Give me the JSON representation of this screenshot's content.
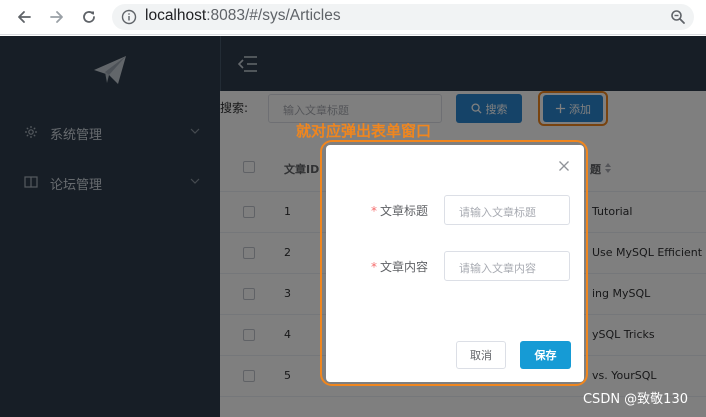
{
  "browser": {
    "url_host": "localhost",
    "url_path": ":8083/#/sys/Articles"
  },
  "sidebar": {
    "items": [
      {
        "label": "系统管理",
        "icon": "gear-icon"
      },
      {
        "label": "论坛管理",
        "icon": "book-icon"
      }
    ]
  },
  "search": {
    "label": "搜索:",
    "placeholder": "输入文章标题",
    "search_button": "搜索",
    "add_button": "添加"
  },
  "annotation": "就对应弹出表单窗口",
  "table": {
    "columns": [
      "文章ID",
      "题"
    ],
    "rows": [
      {
        "id": "1",
        "title": "Tutorial"
      },
      {
        "id": "2",
        "title": "Use MySQL Efficient"
      },
      {
        "id": "3",
        "title": "ing MySQL"
      },
      {
        "id": "4",
        "title": "ySQL Tricks"
      },
      {
        "id": "5",
        "title": "vs. YourSQL"
      }
    ]
  },
  "dialog": {
    "fields": [
      {
        "label": "文章标题",
        "placeholder": "请输入文章标题",
        "required": true
      },
      {
        "label": "文章内容",
        "placeholder": "请输入文章内容",
        "required": true
      }
    ],
    "cancel_button": "取消",
    "save_button": "保存"
  },
  "watermark": "CSDN @致敬130",
  "colors": {
    "sidebar_bg": "#2f3d4c",
    "primary": "#2b87d1",
    "highlight": "#f0861e",
    "required_star": "#f56c6c"
  }
}
